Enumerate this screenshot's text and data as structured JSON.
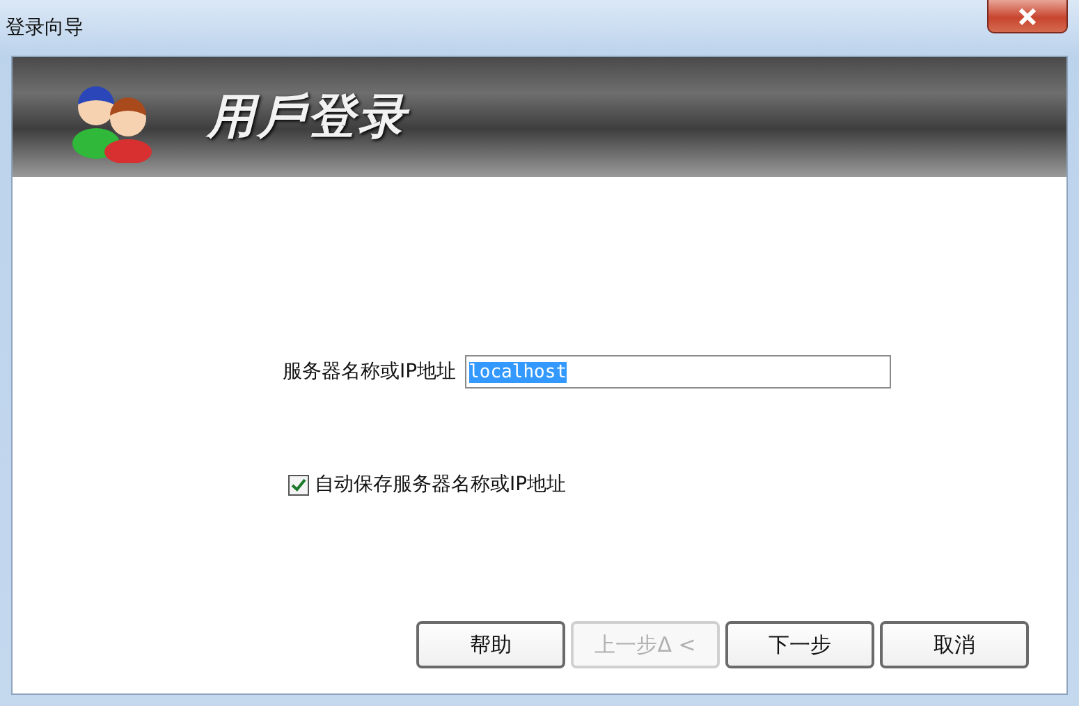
{
  "window": {
    "title": "登录向导"
  },
  "banner": {
    "title": "用戶登录"
  },
  "server": {
    "label": "服务器名称或IP地址",
    "value": "localhost",
    "text_selected": true
  },
  "auto_save": {
    "label": "自动保存服务器名称或IP地址",
    "checked": true
  },
  "buttons": [
    {
      "label": "帮助",
      "disabled": false
    },
    {
      "label": "上一步Δ <",
      "disabled": true
    },
    {
      "label": "下一步",
      "disabled": false
    },
    {
      "label": "取消",
      "disabled": false
    }
  ]
}
